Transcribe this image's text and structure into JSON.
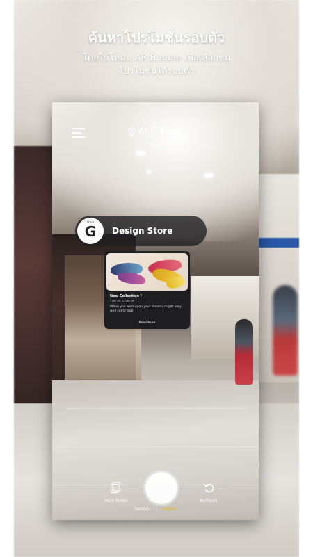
{
  "header": {
    "title": "ค้นหาโปรโมชั่นรอบตัว",
    "subtitle_line1": "โดยใช้โหมด AR Bubble เพื่อเลือกชม",
    "subtitle_line2": "โปรโมชั่นได้รอบตัว"
  },
  "topbar": {
    "location": "At G Floor",
    "icons": [
      "menu-icon",
      "location-pin-icon",
      "chevron-down-icon"
    ]
  },
  "store_bubble": {
    "logo_letter": "G",
    "logo_caption": "Store",
    "name": "Design Store"
  },
  "promo": {
    "title": "New Collection !",
    "date": "1 Jan 19 - 12 Jan 19",
    "description": "When you wish upon your dreams might very well come true.",
    "read_more": "Read More"
  },
  "bottom": {
    "wall_mode": "Wall Mode",
    "refresh": "Refresh",
    "modes": [
      "VIDEO",
      "PHOTO"
    ],
    "selected_mode": "PHOTO",
    "selected_color": "#f5b400",
    "icons": [
      "wall-mode-icon",
      "shutter-button",
      "refresh-icon"
    ]
  }
}
